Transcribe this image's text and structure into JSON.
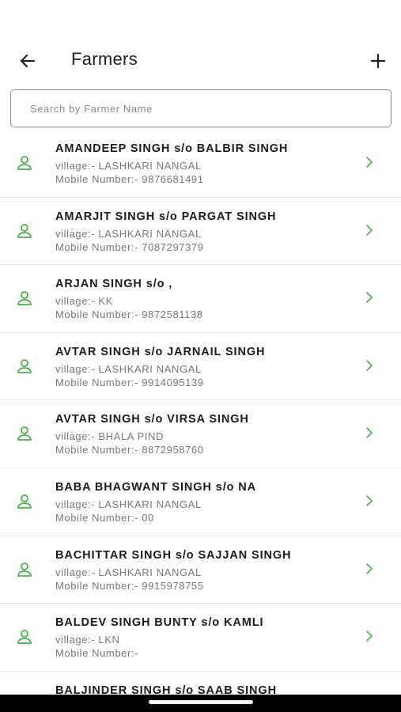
{
  "header": {
    "title": "Farmers",
    "back_icon": "arrow-left-icon",
    "add_icon": "plus-icon"
  },
  "search": {
    "placeholder": "Search by Farmer Name",
    "value": ""
  },
  "colors": {
    "accent_green": "#4caf50",
    "divider": "#e6e6e6"
  },
  "farmers": [
    {
      "name": "AMANDEEP SINGH s/o BALBIR SINGH",
      "village": "village:- LASHKARI NANGAL",
      "mobile": "Mobile Number:- 9876681491"
    },
    {
      "name": "AMARJIT SINGH s/o PARGAT SINGH",
      "village": "village:- LASHKARI NANGAL",
      "mobile": "Mobile Number:- 7087297379"
    },
    {
      "name": "ARJAN SINGH s/o ,",
      "village": "village:- KK",
      "mobile": "Mobile Number:- 9872581138"
    },
    {
      "name": "AVTAR SINGH s/o JARNAIL SINGH",
      "village": "village:- LASHKARI NANGAL",
      "mobile": "Mobile Number:- 9914095139"
    },
    {
      "name": "AVTAR SINGH s/o VIRSA SINGH",
      "village": "village:- BHALA PIND",
      "mobile": "Mobile Number:- 8872958760"
    },
    {
      "name": "BABA BHAGWANT SINGH s/o NA",
      "village": "village:- LASHKARI NANGAL",
      "mobile": "Mobile Number:- 00"
    },
    {
      "name": "BACHITTAR SINGH s/o SAJJAN SINGH",
      "village": "village:- LASHKARI NANGAL",
      "mobile": "Mobile Number:- 9915978755"
    },
    {
      "name": "BALDEV SINGH BUNTY s/o KAMLI",
      "village": "village:- LKN",
      "mobile": "Mobile Number:-"
    },
    {
      "name": "BALJINDER SINGH s/o SAAB SINGH",
      "village": "",
      "mobile": ""
    }
  ]
}
